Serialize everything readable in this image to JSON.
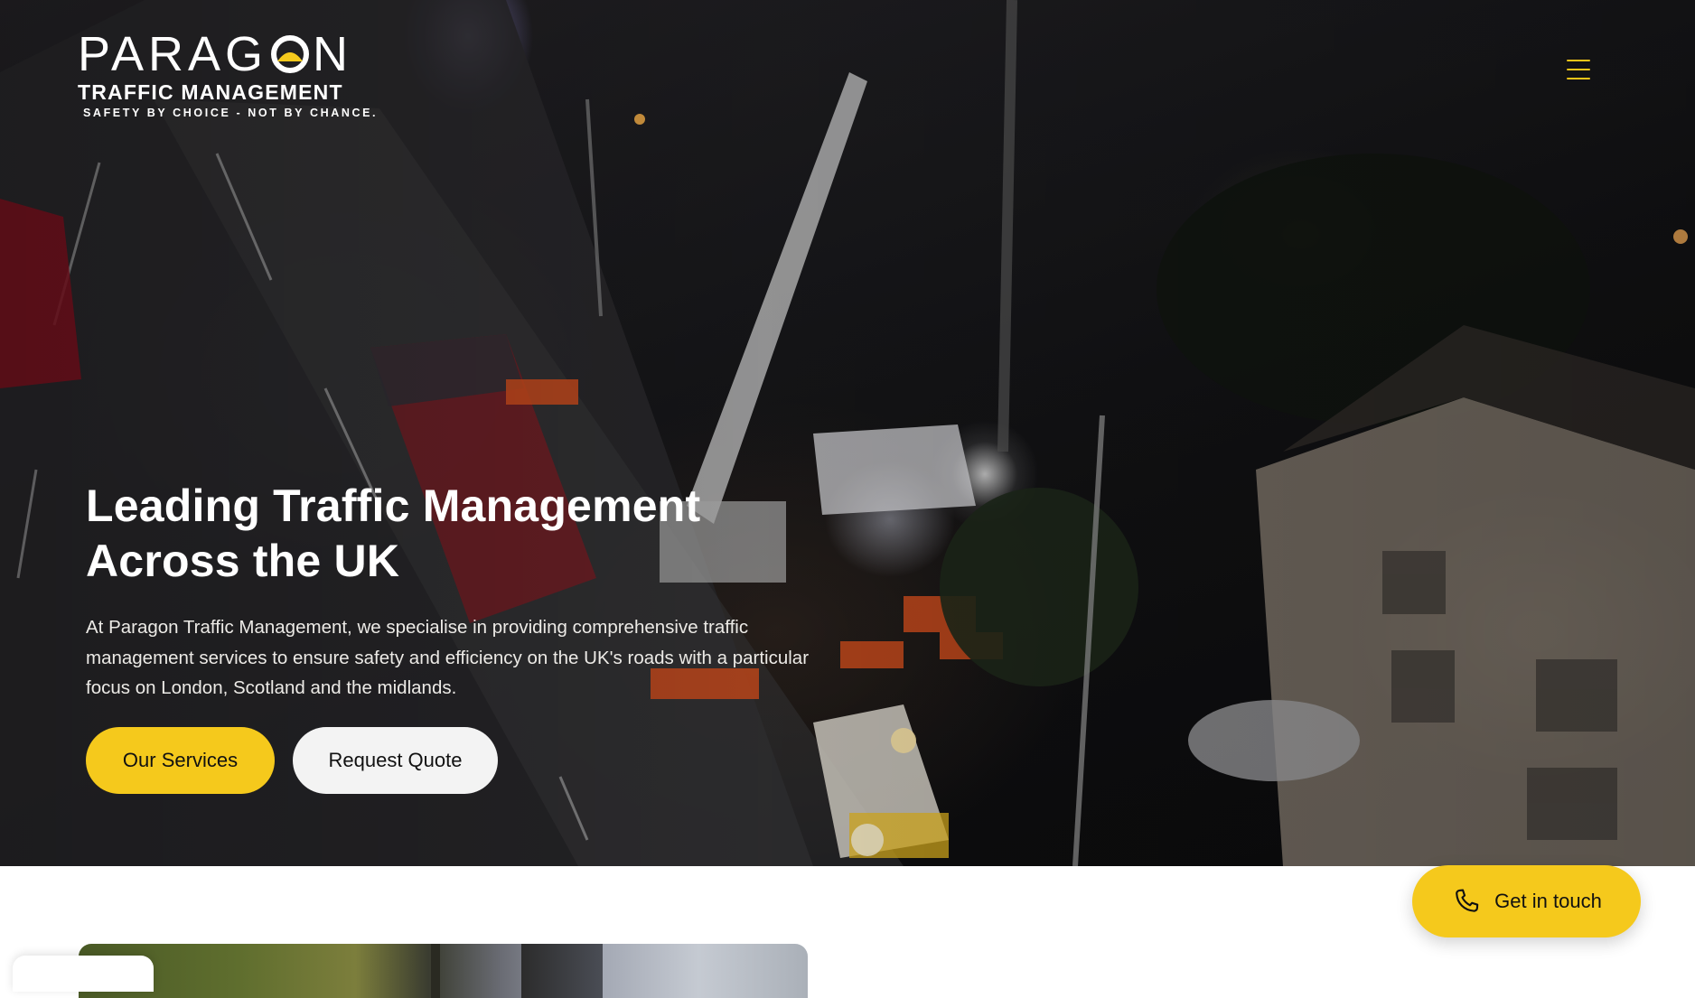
{
  "brand": {
    "name_left": "PARAG",
    "name_right": "N",
    "subtitle": "TRAFFIC MANAGEMENT",
    "tagline": "SAFETY BY CHOICE - NOT BY CHANCE.",
    "accent_color": "#f5c91c"
  },
  "header": {
    "menu_icon": "hamburger-icon"
  },
  "hero": {
    "title": "Leading Traffic Management Across the UK",
    "description": "At Paragon Traffic Management, we specialise in providing comprehensive traffic management services to ensure safety and efficiency on the UK's roads with a particular focus on London, Scotland and the midlands.",
    "primary_button": "Our Services",
    "secondary_button": "Request Quote"
  },
  "contact_cta": {
    "label": "Get in touch",
    "icon": "phone-icon"
  }
}
